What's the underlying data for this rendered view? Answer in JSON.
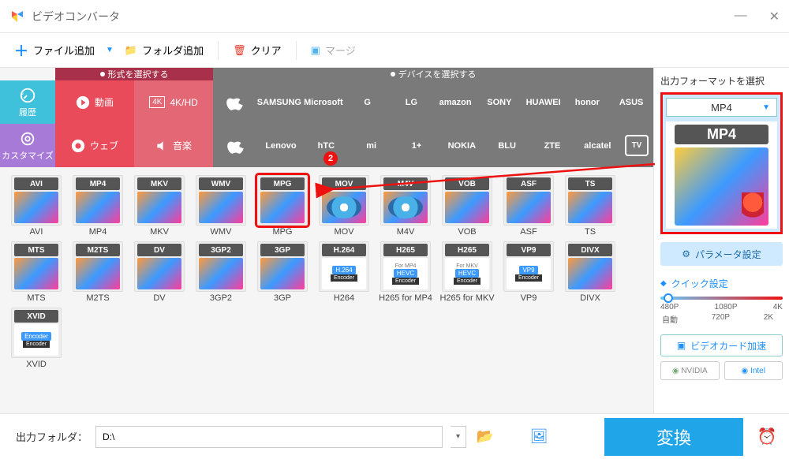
{
  "window": {
    "title": "ビデオコンバータ"
  },
  "toolbar": {
    "add_file": "ファイル追加",
    "add_folder": "フォルダ追加",
    "clear": "クリア",
    "merge": "マージ"
  },
  "category_tabs": {
    "format": "形式を選択する",
    "device": "デバイスを選択する"
  },
  "left_tabs": {
    "history": "履歴",
    "custom": "カスタマイズ"
  },
  "type_cells": {
    "video": "動画",
    "fourk": "4K/HD",
    "web": "ウェブ",
    "music": "音楽"
  },
  "brands_row1": [
    "",
    "SAMSUNG",
    "Microsoft",
    "G",
    "LG",
    "amazon",
    "SONY",
    "HUAWEI",
    "honor",
    "ASUS"
  ],
  "brands_row2": [
    "",
    "Lenovo",
    "hTC",
    "mi",
    "1+",
    "NOKIA",
    "BLU",
    "ZTE",
    "alcatel",
    "TV"
  ],
  "formats": [
    {
      "code": "AVI",
      "label": "AVI",
      "art": "img"
    },
    {
      "code": "MP4",
      "label": "MP4",
      "art": "img"
    },
    {
      "code": "MKV",
      "label": "MKV",
      "art": "mkv"
    },
    {
      "code": "WMV",
      "label": "WMV",
      "art": "img"
    },
    {
      "code": "MPG",
      "label": "MPG",
      "art": "img",
      "selected": true
    },
    {
      "code": "MOV",
      "label": "MOV",
      "art": "disc"
    },
    {
      "code": "M4V",
      "label": "M4V",
      "art": "disc"
    },
    {
      "code": "VOB",
      "label": "VOB",
      "art": "img"
    },
    {
      "code": "ASF",
      "label": "ASF",
      "art": "img"
    },
    {
      "code": "TS",
      "label": "TS",
      "art": "img"
    },
    {
      "code": "MTS",
      "label": "MTS",
      "art": "cam"
    },
    {
      "code": "M2TS",
      "label": "M2TS",
      "art": "cam"
    },
    {
      "code": "DV",
      "label": "DV",
      "art": "cam"
    },
    {
      "code": "3GP2",
      "label": "3GP2",
      "art": "img"
    },
    {
      "code": "3GP",
      "label": "3GP",
      "art": "img"
    },
    {
      "code": "H.264",
      "label": "H264",
      "art": "enc",
      "enc": "H.264"
    },
    {
      "code": "H265",
      "label": "H265 for MP4",
      "art": "enc",
      "enc": "HEVC",
      "sub": "For MP4"
    },
    {
      "code": "H265",
      "label": "H265 for MKV",
      "art": "enc",
      "enc": "HEVC",
      "sub": "For MKV"
    },
    {
      "code": "VP9",
      "label": "VP9",
      "art": "enc",
      "enc": "VP9"
    },
    {
      "code": "DIVX",
      "label": "DIVX",
      "art": "img"
    },
    {
      "code": "XVID",
      "label": "XVID",
      "art": "enc",
      "enc": "Encoder"
    }
  ],
  "side": {
    "title": "出力フォーマットを選択",
    "selected": "MP4",
    "preview_code": "MP4",
    "param": "パラメータ設定",
    "quick": "クイック設定",
    "res": [
      "480P",
      "1080P",
      "4K"
    ],
    "res2": [
      "自動",
      "720P",
      "2K"
    ],
    "gpu": "ビデオカード加速",
    "nvidia": "NVIDIA",
    "intel": "Intel"
  },
  "bottom": {
    "label": "出力フォルダ：",
    "path": "D:\\",
    "convert": "変換"
  },
  "annotation": {
    "num": "2"
  }
}
